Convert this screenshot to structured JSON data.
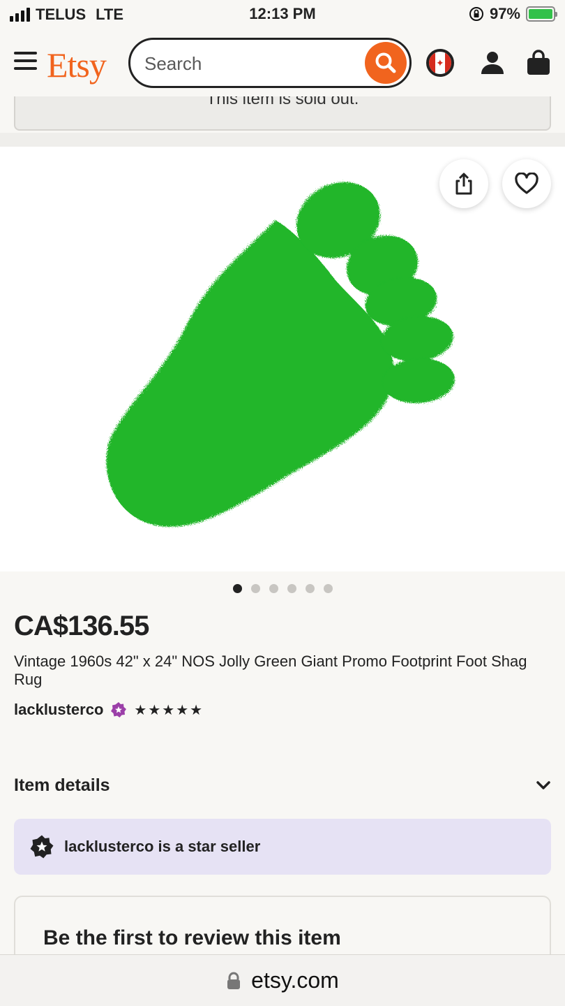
{
  "status_bar": {
    "carrier": "TELUS",
    "network": "LTE",
    "time": "12:13 PM",
    "battery": "97%"
  },
  "header": {
    "logo": "Etsy",
    "search_placeholder": "Search",
    "icons": [
      "menu-icon",
      "search-icon",
      "canada-flag-icon",
      "user-icon",
      "shopping-bag-icon"
    ]
  },
  "notice": {
    "sold_out": "This item is sold out."
  },
  "gallery": {
    "total_images": 6,
    "active_index": 0,
    "icons": [
      "share-icon",
      "heart-icon"
    ]
  },
  "listing": {
    "price": "CA$136.55",
    "title": "Vintage 1960s 42\" x 24\" NOS Jolly Green Giant Promo Footprint Foot Shag Rug",
    "seller": "lacklusterco",
    "rating_stars": "★★★★★"
  },
  "sections": {
    "item_details": "Item details",
    "star_seller": "lacklusterco is a star seller",
    "review_prompt": "Be the first to review this item"
  },
  "browser": {
    "url": "etsy.com"
  },
  "colors": {
    "brand": "#f1641e",
    "rug_green": "#20b62a",
    "star_seller_bg": "#e6e2f4",
    "star_seller_badge": "#9b3fa8"
  }
}
